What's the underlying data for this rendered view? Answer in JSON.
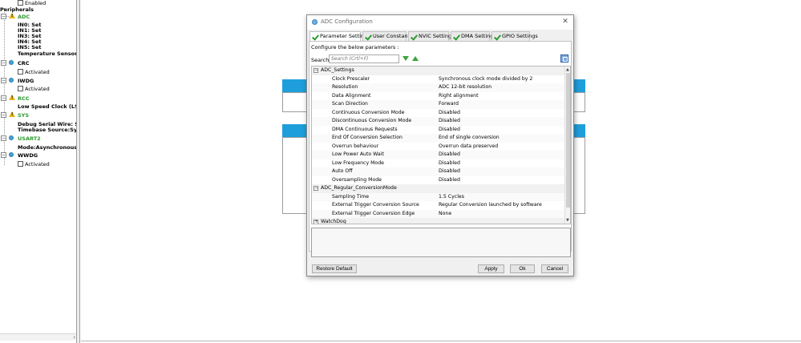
{
  "tree": {
    "enabled_label": "Enabled",
    "peripherals_label": "Peripherals",
    "adc": {
      "label": "ADC",
      "items": [
        "IN0: Set",
        "IN1: Set",
        "IN3: Set",
        "IN4: Set",
        "IN5: Set",
        "Temperature Sensor Cha"
      ]
    },
    "crc": {
      "label": "CRC",
      "items": [
        "Activated"
      ]
    },
    "iwdg": {
      "label": "IWDG",
      "items": [
        "Activated"
      ]
    },
    "rcc": {
      "label": "RCC",
      "items": [
        "Low Speed Clock (LSE) :C"
      ]
    },
    "sys": {
      "label": "SYS",
      "items": [
        "Debug Serial Wire: Set",
        "Timebase Source:SysTick"
      ]
    },
    "usart2": {
      "label": "USART2",
      "items": [
        "Mode:Asynchronous"
      ]
    },
    "wwdg": {
      "label": "WWDG",
      "items": [
        "Activated"
      ]
    }
  },
  "dialog": {
    "title": "ADC Configuration",
    "close_glyph": "✕",
    "tabs": [
      {
        "label": "Parameter Settings"
      },
      {
        "label": "User Constants"
      },
      {
        "label": "NVIC Settings"
      },
      {
        "label": "DMA Settings"
      },
      {
        "label": "GPIO Settings"
      }
    ],
    "configure_text": "Configure the below parameters :",
    "search_label": "Search :",
    "search_placeholder": "Search (Crtl+F)",
    "groups": [
      {
        "label": "ADC_Settings",
        "rows": [
          {
            "name": "Clock Prescaler",
            "value": "Synchronous clock mode divided by 2"
          },
          {
            "name": "Resolution",
            "value": "ADC 12-bit resolution"
          },
          {
            "name": "Data Alignment",
            "value": "Right alignment"
          },
          {
            "name": "Scan Direction",
            "value": "Forward"
          },
          {
            "name": "Continuous Conversion Mode",
            "value": "Disabled"
          },
          {
            "name": "Discontinuous Conversion Mode",
            "value": "Disabled"
          },
          {
            "name": "DMA Continuous Requests",
            "value": "Disabled"
          },
          {
            "name": "End Of Conversion Selection",
            "value": "End of single conversion"
          },
          {
            "name": "Overrun behaviour",
            "value": "Overrun data preserved"
          },
          {
            "name": "Low Power Auto Wait",
            "value": "Disabled"
          },
          {
            "name": "Low Frequency Mode",
            "value": "Disabled"
          },
          {
            "name": "Auto Off",
            "value": "Disabled"
          },
          {
            "name": "Oversampling Mode",
            "value": "Disabled"
          }
        ]
      },
      {
        "label": "ADC_Regular_ConversionMode",
        "rows": [
          {
            "name": "Sampling Time",
            "value": "1.5 Cycles"
          },
          {
            "name": "External Trigger Conversion Source",
            "value": "Regular Conversion launched by software"
          },
          {
            "name": "External Trigger Conversion Edge",
            "value": "None"
          }
        ]
      },
      {
        "label": "WatchDog",
        "rows": []
      }
    ],
    "buttons": {
      "restore_default": "Restore Default",
      "apply": "Apply",
      "ok": "Ok",
      "cancel": "Cancel"
    }
  }
}
